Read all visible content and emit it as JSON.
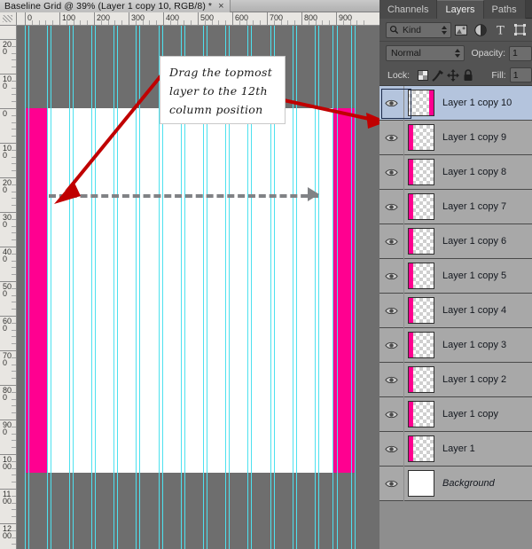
{
  "document": {
    "title": "Baseline Grid @ 39% (Layer 1 copy 10, RGB/8) *",
    "close_label": "×",
    "zoom_percent": "39%",
    "color_mode": "RGB/8"
  },
  "rulers": {
    "horizontal_labels": [
      "0",
      "100",
      "200",
      "300",
      "400",
      "500",
      "600",
      "700",
      "800",
      "900"
    ],
    "vertical_labels": [
      "200",
      "100",
      "0",
      "100",
      "200",
      "300",
      "400",
      "500",
      "600",
      "700",
      "800",
      "900",
      "1000",
      "1100",
      "1200"
    ],
    "unit": "pixels"
  },
  "note": {
    "lines": [
      "Drag the topmost",
      "layer to the 12th",
      "column position"
    ]
  },
  "canvas": {
    "paper_color": "#ffffff",
    "background_color": "#6e6e6e",
    "column_color": "#ff0090",
    "guide_color": "#4de1ef",
    "arrow_color": "#808285",
    "annotation_color": "#c00000"
  },
  "panel": {
    "tabs": [
      {
        "label": "Channels",
        "active": false
      },
      {
        "label": "Layers",
        "active": true
      },
      {
        "label": "Paths",
        "active": false
      }
    ],
    "filter": {
      "search_icon": "search-icon",
      "kind_label": "Kind",
      "icons": [
        "pixel-filter-icon",
        "adjustment-filter-icon",
        "type-filter-icon",
        "shape-filter-icon"
      ]
    },
    "blend": {
      "mode": "Normal",
      "opacity_label": "Opacity:",
      "opacity_value": "1",
      "fill_label": "Fill:",
      "fill_value": "1"
    },
    "lock": {
      "label": "Lock:",
      "icons": [
        "lock-transparency-icon",
        "lock-image-icon",
        "lock-position-icon",
        "lock-all-icon"
      ]
    },
    "layers": [
      {
        "name": "Layer 1 copy 10",
        "selected": true,
        "visible": true,
        "bar": "right",
        "transparent": true,
        "italic": false
      },
      {
        "name": "Layer 1 copy 9",
        "selected": false,
        "visible": true,
        "bar": "left",
        "transparent": true,
        "italic": false
      },
      {
        "name": "Layer 1 copy 8",
        "selected": false,
        "visible": true,
        "bar": "left",
        "transparent": true,
        "italic": false
      },
      {
        "name": "Layer 1 copy 7",
        "selected": false,
        "visible": true,
        "bar": "left",
        "transparent": true,
        "italic": false
      },
      {
        "name": "Layer 1 copy 6",
        "selected": false,
        "visible": true,
        "bar": "left",
        "transparent": true,
        "italic": false
      },
      {
        "name": "Layer 1 copy 5",
        "selected": false,
        "visible": true,
        "bar": "left",
        "transparent": true,
        "italic": false
      },
      {
        "name": "Layer 1 copy 4",
        "selected": false,
        "visible": true,
        "bar": "left",
        "transparent": true,
        "italic": false
      },
      {
        "name": "Layer 1 copy 3",
        "selected": false,
        "visible": true,
        "bar": "left",
        "transparent": true,
        "italic": false
      },
      {
        "name": "Layer 1 copy 2",
        "selected": false,
        "visible": true,
        "bar": "left",
        "transparent": true,
        "italic": false
      },
      {
        "name": "Layer 1 copy",
        "selected": false,
        "visible": true,
        "bar": "left",
        "transparent": true,
        "italic": false
      },
      {
        "name": "Layer 1",
        "selected": false,
        "visible": true,
        "bar": "left",
        "transparent": true,
        "italic": false
      },
      {
        "name": "Background",
        "selected": false,
        "visible": true,
        "bar": "none",
        "transparent": false,
        "italic": true
      }
    ]
  }
}
